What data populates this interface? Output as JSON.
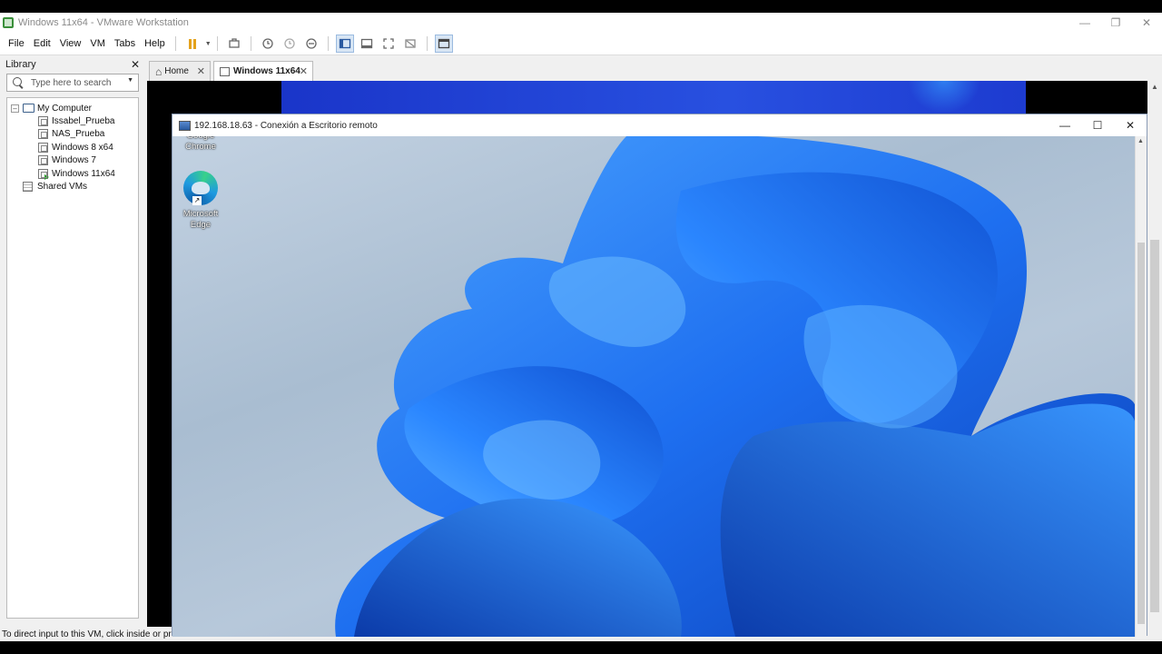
{
  "window": {
    "title": "Windows 11x64 - VMware Workstation",
    "controls": [
      "—",
      "❐",
      "✕"
    ]
  },
  "menubar": {
    "items": [
      "File",
      "Edit",
      "View",
      "VM",
      "Tabs",
      "Help"
    ]
  },
  "toolbar": {
    "icons": [
      "pause-icon",
      "send-ctrl-alt-del-icon",
      "snapshot-icon",
      "revert-snapshot-icon",
      "snapshot-manager-icon",
      "library-view-icon",
      "console-view-icon",
      "fullscreen-icon",
      "unity-icon",
      "thumbnail-icon"
    ]
  },
  "library": {
    "header": "Library",
    "close": "✕",
    "search": {
      "placeholder": "Type here to search"
    },
    "root": {
      "label": "My Computer",
      "expander": "–"
    },
    "vms": [
      {
        "label": "Issabel_Prueba",
        "running": false
      },
      {
        "label": "NAS_Prueba",
        "running": false
      },
      {
        "label": "Windows 8 x64",
        "running": false
      },
      {
        "label": "Windows 7",
        "running": false
      },
      {
        "label": "Windows 11x64",
        "running": true
      }
    ],
    "shared": "Shared VMs"
  },
  "tabs": [
    {
      "label": "Home",
      "close": "✕",
      "active": false
    },
    {
      "label": "Windows 11x64",
      "close": "✕",
      "active": true
    }
  ],
  "rdp": {
    "title": "192.168.18.63 - Conexión a Escritorio remoto",
    "controls": [
      "—",
      "☐",
      "✕"
    ],
    "desktop_icons": [
      {
        "label": "Google\nChrome"
      },
      {
        "label": "Microsoft\nEdge"
      }
    ]
  },
  "statusbar": {
    "text": "To direct input to this VM, click inside or press Ctrl+G."
  },
  "colors": {
    "accent": "#1f5bd8",
    "pause": "#e4a21c",
    "running": "#2ca02c",
    "wallpaper_blue": "#1f6be8"
  }
}
